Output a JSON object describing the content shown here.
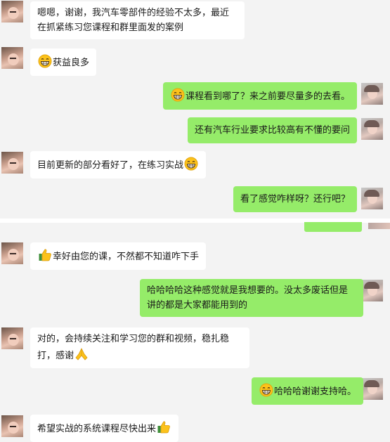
{
  "messages": [
    {
      "side": "left",
      "avatar": "baby-avatar",
      "text": "嗯嗯，谢谢，我汽车零部件的经验不太多，最近在抓紧练习您课程和群里面发的案例"
    },
    {
      "side": "left",
      "avatar": "baby-avatar",
      "emoji_before": "grin-emoji",
      "text": "获益良多"
    },
    {
      "side": "right",
      "avatar": "girl-avatar",
      "emoji_before": "grin-emoji",
      "text": "课程看到哪了？来之前要尽量多的去看。"
    },
    {
      "side": "right",
      "avatar": "girl-avatar",
      "text": "还有汽车行业要求比较高有不懂的要问"
    },
    {
      "side": "left",
      "avatar": "baby-avatar",
      "text": "目前更新的部分看好了，在练习实战",
      "emoji_after": "grin-emoji"
    },
    {
      "side": "right",
      "avatar": "girl-avatar",
      "text": "看了感觉咋样呀？还行吧？"
    },
    {
      "side": "left",
      "avatar": "baby-avatar",
      "emoji_before": "thumbs-up-emoji",
      "text": "幸好由您的课，不然都不知道咋下手"
    },
    {
      "side": "right",
      "avatar": "girl-avatar",
      "text": "哈哈哈哈这种感觉就是我想要的。没太多废话但是讲的都是大家都能用到的"
    },
    {
      "side": "left",
      "avatar": "baby-avatar",
      "text": "对的，会持续关注和学习您的群和视频，稳扎稳打，感谢",
      "emoji_after": "pray-emoji"
    },
    {
      "side": "right",
      "avatar": "girl-avatar",
      "emoji_before": "grin-emoji",
      "text": "哈哈哈谢谢支持哈。"
    },
    {
      "side": "left",
      "avatar": "baby-avatar",
      "text": "希望实战的系统课程尽快出来",
      "emoji_after": "thumbs-up-emoji"
    }
  ]
}
